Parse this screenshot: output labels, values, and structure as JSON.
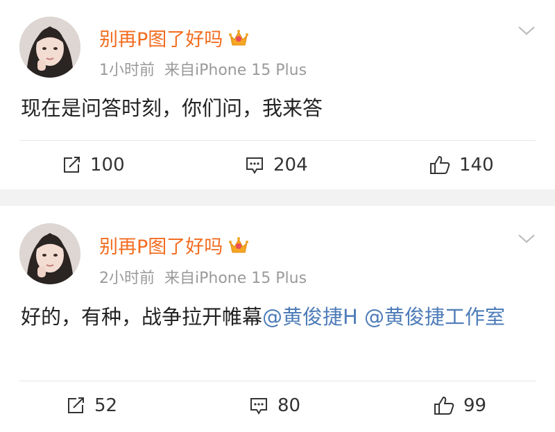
{
  "posts": [
    {
      "username": "别再P图了好吗",
      "time": "1小时前",
      "source": "来自iPhone 15 Plus",
      "content": [
        {
          "text": "现在是问答时刻，你们问，我来答",
          "mention": false
        }
      ],
      "reposts": "100",
      "comments": "204",
      "likes": "140"
    },
    {
      "username": "别再P图了好吗",
      "time": "2小时前",
      "source": "来自iPhone 15 Plus",
      "content": [
        {
          "text": "好的，有种，战争拉开帷幕",
          "mention": false
        },
        {
          "text": "@黄俊捷H",
          "mention": true
        },
        {
          "text": " ",
          "mention": false
        },
        {
          "text": "@黄俊捷工作室",
          "mention": true
        }
      ],
      "reposts": "52",
      "comments": "80",
      "likes": "99"
    }
  ],
  "colors": {
    "username": "#f26c1f",
    "mention": "#4e7cb8",
    "meta": "#9a9a9a",
    "separator_band": "#f2f2f2"
  },
  "icons": [
    "user-avatar",
    "vip-crown-icon",
    "chevron-down-icon",
    "repost-icon",
    "comment-icon",
    "like-icon"
  ]
}
